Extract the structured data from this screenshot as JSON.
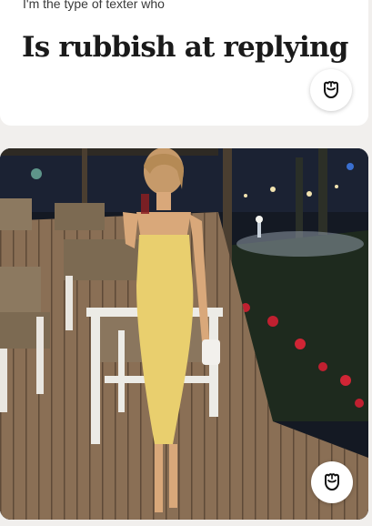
{
  "prompt_card": {
    "prompt": "I'm the type of texter who",
    "answer": "Is rubbish at replying",
    "like_icon": "rose-icon"
  },
  "photo_card": {
    "image_description": "photo",
    "like_icon": "rose-icon"
  },
  "colors": {
    "background": "#f1efed",
    "card": "#ffffff",
    "text": "#1a1a1a"
  }
}
